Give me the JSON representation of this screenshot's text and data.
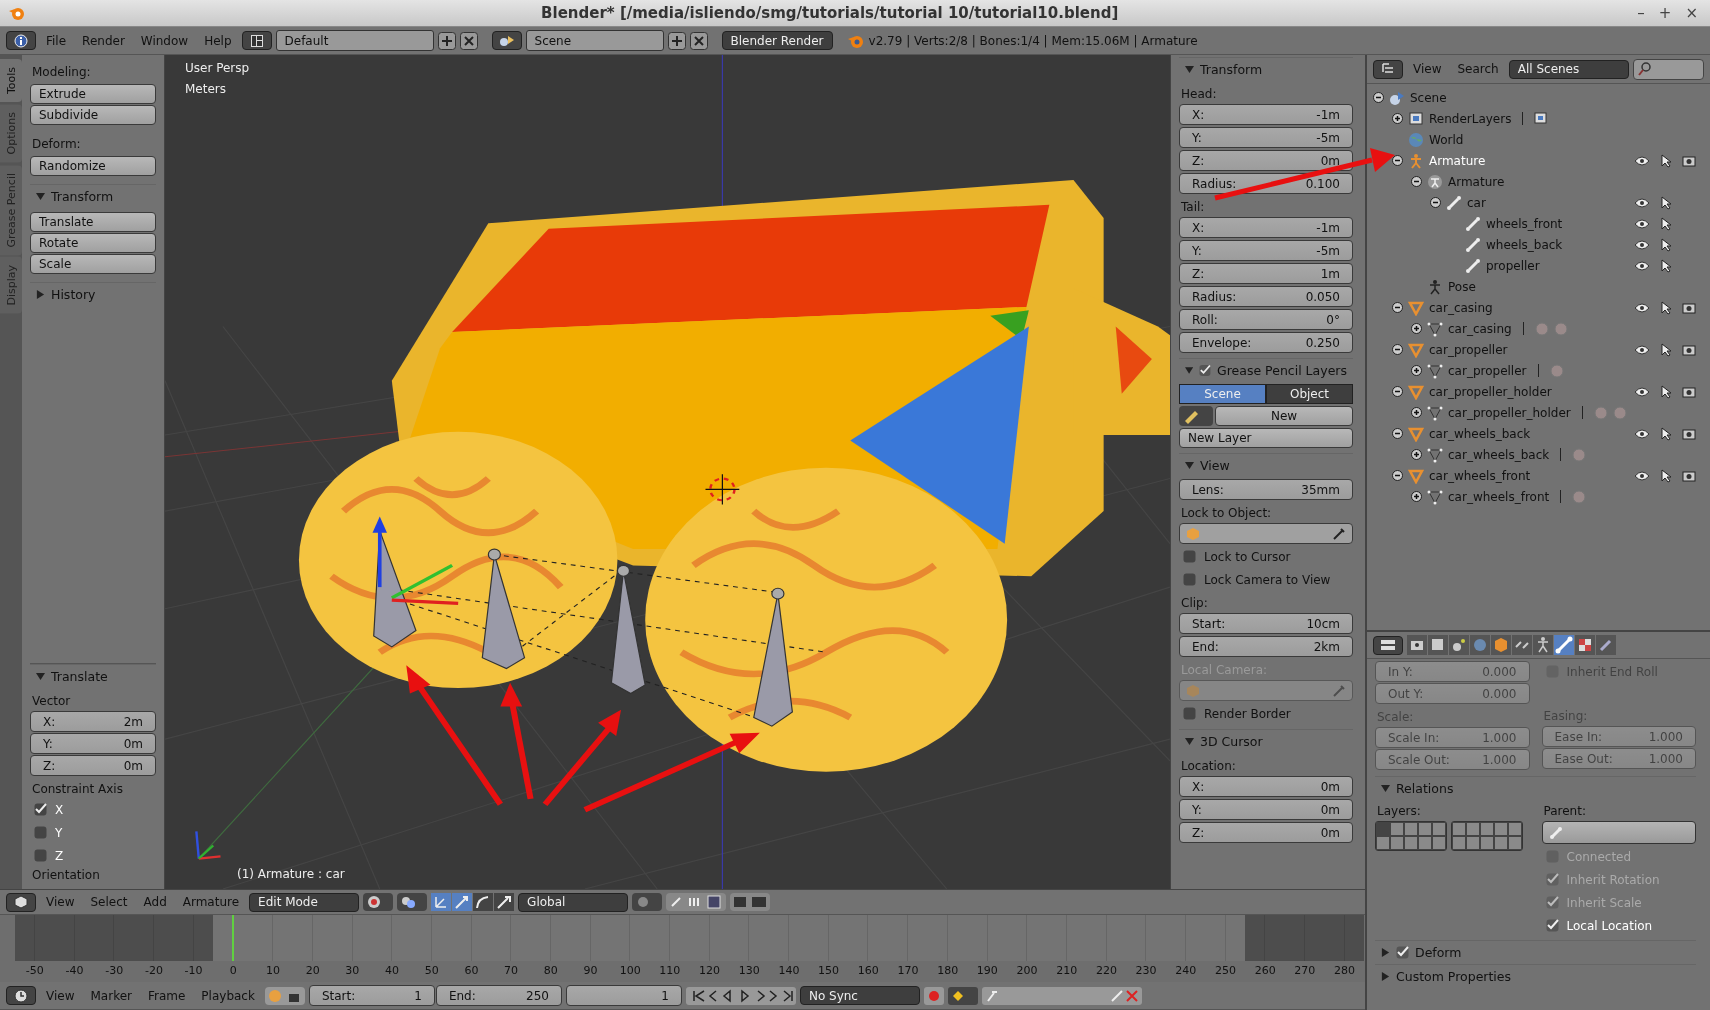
{
  "window": {
    "title": "Blender* [/media/isliendo/smg/tutorials/tutorial 10/tutorial10.blend]",
    "controls": [
      "–",
      "+",
      "×"
    ]
  },
  "top_header": {
    "menus": [
      "File",
      "Render",
      "Window",
      "Help"
    ],
    "layout": "Default",
    "scene": "Scene",
    "engine": "Blender Render",
    "stats": "v2.79 | Verts:2/8 | Bones:1/4 | Mem:15.06M | Armature"
  },
  "tool_shelf": {
    "tabs": [
      {
        "label": "Tools",
        "selected": true
      },
      {
        "label": "Options",
        "selected": false
      },
      {
        "label": "Grease Pencil",
        "selected": false
      },
      {
        "label": "Display",
        "selected": false
      }
    ],
    "items": [
      {
        "kind": "label",
        "text": "Modeling:"
      },
      {
        "kind": "buttons",
        "labels": [
          "Extrude",
          "Subdivide"
        ]
      },
      {
        "kind": "label",
        "text": "Deform:"
      },
      {
        "kind": "buttons",
        "labels": [
          "Randomize"
        ]
      },
      {
        "kind": "panel",
        "title": "Transform",
        "expanded": true
      },
      {
        "kind": "buttons",
        "labels": [
          "Translate",
          "Rotate",
          "Scale"
        ]
      },
      {
        "kind": "panel",
        "title": "History",
        "expanded": false
      }
    ]
  },
  "operator_panel": {
    "title": "Translate",
    "expanded": true,
    "vector_label": "Vector",
    "fields": [
      {
        "label": "X:",
        "value": "2m"
      },
      {
        "label": "Y:",
        "value": "0m"
      },
      {
        "label": "Z:",
        "value": "0m"
      }
    ],
    "constraint_label": "Constraint Axis",
    "axes": [
      {
        "label": "X",
        "checked": true
      },
      {
        "label": "Y",
        "checked": false
      },
      {
        "label": "Z",
        "checked": false
      }
    ],
    "orientation_label": "Orientation"
  },
  "viewport": {
    "view_name": "User Persp",
    "units": "Meters",
    "object_info": "(1) Armature : car"
  },
  "n_panel": {
    "panels": [
      {
        "title": "Transform",
        "expanded": true,
        "rows": [
          {
            "kind": "label",
            "text": "Head:",
            "disabled": false
          },
          {
            "kind": "field",
            "label": "X:",
            "value": "-1m"
          },
          {
            "kind": "field",
            "label": "Y:",
            "value": "-5m"
          },
          {
            "kind": "field",
            "label": "Z:",
            "value": "0m"
          },
          {
            "kind": "field",
            "label": "Radius:",
            "value": "0.100"
          },
          {
            "kind": "label",
            "text": "Tail:",
            "disabled": false
          },
          {
            "kind": "field",
            "label": "X:",
            "value": "-1m"
          },
          {
            "kind": "field",
            "label": "Y:",
            "value": "-5m"
          },
          {
            "kind": "field",
            "label": "Z:",
            "value": "1m"
          },
          {
            "kind": "field",
            "label": "Radius:",
            "value": "0.050"
          },
          {
            "kind": "field",
            "label": "Roll:",
            "value": "0°"
          },
          {
            "kind": "field",
            "label": "Envelope:",
            "value": "0.250"
          }
        ]
      },
      {
        "title": "Grease Pencil Layers",
        "expanded": true,
        "enabled": true,
        "rows": [
          {
            "kind": "toggle",
            "options": [
              {
                "label": "Scene",
                "selected": true
              },
              {
                "label": "Object",
                "selected": false
              }
            ]
          },
          {
            "kind": "new",
            "label": "New"
          },
          {
            "kind": "button",
            "label": "New Layer"
          }
        ]
      },
      {
        "title": "View",
        "expanded": true,
        "rows": [
          {
            "kind": "field",
            "label": "Lens:",
            "value": "35mm"
          },
          {
            "kind": "label",
            "text": "Lock to Object:",
            "disabled": false
          },
          {
            "kind": "object",
            "disabled": false
          },
          {
            "kind": "checkbox",
            "label": "Lock to Cursor",
            "checked": false
          },
          {
            "kind": "checkbox",
            "label": "Lock Camera to View",
            "checked": false
          },
          {
            "kind": "label",
            "text": "Clip:",
            "disabled": false
          },
          {
            "kind": "field",
            "label": "Start:",
            "value": "10cm"
          },
          {
            "kind": "field",
            "label": "End:",
            "value": "2km"
          },
          {
            "kind": "label",
            "text": "Local Camera:",
            "disabled": true
          },
          {
            "kind": "object",
            "disabled": true
          },
          {
            "kind": "checkbox",
            "label": "Render Border",
            "checked": false
          }
        ]
      },
      {
        "title": "3D Cursor",
        "expanded": true,
        "rows": [
          {
            "kind": "label",
            "text": "Location:",
            "disabled": false
          },
          {
            "kind": "field",
            "label": "X:",
            "value": "0m"
          },
          {
            "kind": "field",
            "label": "Y:",
            "value": "0m"
          },
          {
            "kind": "field",
            "label": "Z:",
            "value": "0m"
          }
        ]
      }
    ]
  },
  "outliner": {
    "menus": [
      "View",
      "Search"
    ],
    "filter": "All Scenes",
    "tree": [
      {
        "label": "Scene",
        "kind": "scene",
        "expanded": true,
        "selected": false,
        "children": [
          {
            "label": "RenderLayers",
            "kind": "render_layers",
            "expanded": false,
            "selected": false,
            "extras": [
              {
                "kind": "render_layers"
              }
            ]
          },
          {
            "label": "World",
            "kind": "world",
            "selected": false
          },
          {
            "label": "Armature",
            "kind": "armature_object",
            "expanded": true,
            "selected": true,
            "children": [
              {
                "label": "Armature",
                "kind": "armature_data",
                "expanded": true,
                "selected": false,
                "children": [
                  {
                    "label": "car",
                    "kind": "bone",
                    "expanded": true,
                    "selected": false,
                    "children": [
                      {
                        "label": "wheels_front",
                        "kind": "bone",
                        "selected": false
                      },
                      {
                        "label": "wheels_back",
                        "kind": "bone",
                        "selected": false
                      },
                      {
                        "label": "propeller",
                        "kind": "bone",
                        "selected": false
                      }
                    ]
                  }
                ]
              },
              {
                "label": "Pose",
                "kind": "pose",
                "selected": false
              }
            ]
          },
          {
            "label": "car_casing",
            "kind": "mesh_object",
            "expanded": true,
            "selected": false,
            "children": [
              {
                "label": "car_casing",
                "kind": "mesh_data",
                "expanded": false,
                "selected": false,
                "extras": [
                  {
                    "kind": "material"
                  },
                  {
                    "kind": "material"
                  }
                ]
              }
            ]
          },
          {
            "label": "car_propeller",
            "kind": "mesh_object",
            "expanded": true,
            "selected": false,
            "children": [
              {
                "label": "car_propeller",
                "kind": "mesh_data",
                "expanded": false,
                "selected": false,
                "extras": [
                  {
                    "kind": "material"
                  }
                ]
              }
            ]
          },
          {
            "label": "car_propeller_holder",
            "kind": "mesh_object",
            "expanded": true,
            "selected": false,
            "children": [
              {
                "label": "car_propeller_holder",
                "kind": "mesh_data",
                "expanded": false,
                "selected": false,
                "extras": [
                  {
                    "kind": "material"
                  },
                  {
                    "kind": "material"
                  }
                ]
              }
            ]
          },
          {
            "label": "car_wheels_back",
            "kind": "mesh_object",
            "expanded": true,
            "selected": false,
            "children": [
              {
                "label": "car_wheels_back",
                "kind": "mesh_data",
                "expanded": false,
                "selected": false,
                "extras": [
                  {
                    "kind": "material"
                  }
                ]
              }
            ]
          },
          {
            "label": "car_wheels_front",
            "kind": "mesh_object",
            "expanded": true,
            "selected": false,
            "children": [
              {
                "label": "car_wheels_front",
                "kind": "mesh_data",
                "expanded": false,
                "selected": false,
                "extras": [
                  {
                    "kind": "material"
                  }
                ]
              }
            ]
          }
        ]
      }
    ]
  },
  "properties": {
    "tabs": [
      {
        "kind": "render",
        "selected": false
      },
      {
        "kind": "render_layers",
        "selected": false
      },
      {
        "kind": "scene",
        "selected": false
      },
      {
        "kind": "world",
        "selected": false
      },
      {
        "kind": "object",
        "selected": false
      },
      {
        "kind": "constraints",
        "selected": false
      },
      {
        "kind": "armature",
        "selected": false
      },
      {
        "kind": "bone",
        "selected": true
      },
      {
        "kind": "texture",
        "selected": false
      },
      {
        "kind": "bone_constraints",
        "selected": false
      }
    ],
    "bone_section": {
      "disabled": true,
      "fields": [
        {
          "label": "In Y:",
          "value": "0.000"
        },
        {
          "label": "Out Y:",
          "value": "0.000"
        }
      ],
      "end_roll": {
        "label": "Inherit End Roll",
        "checked": false
      },
      "scale_label": "Scale:",
      "scale_fields": [
        {
          "label": "Scale In:",
          "value": "1.000"
        },
        {
          "label": "Scale Out:",
          "value": "1.000"
        }
      ],
      "easing_label": "Easing:",
      "easing_fields": [
        {
          "label": "Ease In:",
          "value": "1.000"
        },
        {
          "label": "Ease Out:",
          "value": "1.000"
        }
      ]
    },
    "relations": {
      "title": "Relations",
      "expanded": true,
      "layers_label": "Layers:",
      "parent_label": "Parent:",
      "layers": [
        {
          "selected": true
        },
        {
          "selected": false
        },
        {
          "selected": false
        },
        {
          "selected": false
        },
        {
          "selected": false
        },
        {
          "selected": false
        },
        {
          "selected": false
        },
        {
          "selected": false
        },
        {
          "selected": false
        },
        {
          "selected": false
        },
        {
          "selected": false
        },
        {
          "selected": false
        },
        {
          "selected": false
        },
        {
          "selected": false
        },
        {
          "selected": false
        },
        {
          "selected": false
        },
        {
          "selected": false
        },
        {
          "selected": false
        },
        {
          "selected": false
        },
        {
          "selected": false
        }
      ],
      "options": [
        {
          "label": "Connected",
          "checked": false,
          "disabled": true
        },
        {
          "label": "Inherit Rotation",
          "checked": true,
          "disabled": true
        },
        {
          "label": "Inherit Scale",
          "checked": true,
          "disabled": true
        },
        {
          "label": "Local Location",
          "checked": true,
          "disabled": false
        }
      ]
    },
    "collapsed_panels": [
      {
        "title": "Deform",
        "expanded": false,
        "enabled": true
      },
      {
        "title": "Custom Properties",
        "expanded": false
      }
    ]
  },
  "view3d_header": {
    "menus": [
      "View",
      "Select",
      "Add",
      "Armature"
    ],
    "mode": "Edit Mode",
    "orientation": "Global",
    "manipulators": [
      {
        "kind": "toggle",
        "selected": true
      },
      {
        "kind": "translate",
        "selected": true
      },
      {
        "kind": "rotate",
        "selected": false
      },
      {
        "kind": "scale",
        "selected": false
      }
    ]
  },
  "timeline": {
    "ticks": [
      {
        "label": "-50",
        "in_range": false,
        "current": false
      },
      {
        "label": "-40",
        "in_range": false,
        "current": false
      },
      {
        "label": "-30",
        "in_range": false,
        "current": false
      },
      {
        "label": "-20",
        "in_range": false,
        "current": false
      },
      {
        "label": "-10",
        "in_range": false,
        "current": false
      },
      {
        "label": "0",
        "in_range": true,
        "current": true
      },
      {
        "label": "10",
        "in_range": true,
        "current": false
      },
      {
        "label": "20",
        "in_range": true,
        "current": false
      },
      {
        "label": "30",
        "in_range": true,
        "current": false
      },
      {
        "label": "40",
        "in_range": true,
        "current": false
      },
      {
        "label": "50",
        "in_range": true,
        "current": false
      },
      {
        "label": "60",
        "in_range": true,
        "current": false
      },
      {
        "label": "70",
        "in_range": true,
        "current": false
      },
      {
        "label": "80",
        "in_range": true,
        "current": false
      },
      {
        "label": "90",
        "in_range": true,
        "current": false
      },
      {
        "label": "100",
        "in_range": true,
        "current": false
      },
      {
        "label": "110",
        "in_range": true,
        "current": false
      },
      {
        "label": "120",
        "in_range": true,
        "current": false
      },
      {
        "label": "130",
        "in_range": true,
        "current": false
      },
      {
        "label": "140",
        "in_range": true,
        "current": false
      },
      {
        "label": "150",
        "in_range": true,
        "current": false
      },
      {
        "label": "160",
        "in_range": true,
        "current": false
      },
      {
        "label": "170",
        "in_range": true,
        "current": false
      },
      {
        "label": "180",
        "in_range": true,
        "current": false
      },
      {
        "label": "190",
        "in_range": true,
        "current": false
      },
      {
        "label": "200",
        "in_range": true,
        "current": false
      },
      {
        "label": "210",
        "in_range": true,
        "current": false
      },
      {
        "label": "220",
        "in_range": true,
        "current": false
      },
      {
        "label": "230",
        "in_range": true,
        "current": false
      },
      {
        "label": "240",
        "in_range": true,
        "current": false
      },
      {
        "label": "250",
        "in_range": true,
        "current": false
      },
      {
        "label": "260",
        "in_range": false,
        "current": false
      },
      {
        "label": "270",
        "in_range": false,
        "current": false
      },
      {
        "label": "280",
        "in_range": false,
        "current": false
      }
    ]
  },
  "timeline_header": {
    "menus": [
      "View",
      "Marker",
      "Frame",
      "Playback"
    ],
    "start": {
      "label": "Start:",
      "value": "1"
    },
    "end": {
      "label": "End:",
      "value": "250"
    },
    "current": "1",
    "sync": "No Sync"
  }
}
